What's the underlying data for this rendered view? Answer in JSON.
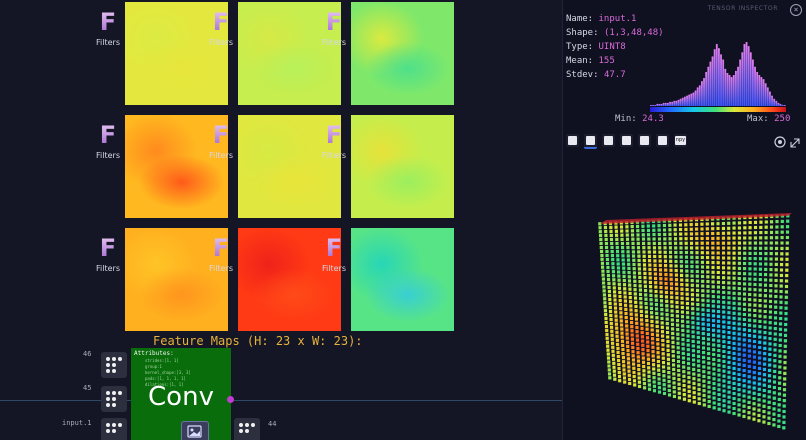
{
  "canvas": {
    "filter_label": "Filters",
    "filter_letter": "F",
    "feature_maps_caption": "Feature Maps (H: 23 x W: 23):",
    "rows": [
      {
        "maps": [
          {
            "colors": [
              "#e4e83e",
              "#dceb42",
              "#e6e63c"
            ]
          },
          {
            "colors": [
              "#c6ee4e",
              "#d6e946",
              "#b8f05a"
            ]
          },
          {
            "colors": [
              "#7fe86a",
              "#d9ea40",
              "#4fe08a"
            ]
          }
        ]
      },
      {
        "maps": [
          {
            "colors": [
              "#ffb81f",
              "#ff8a1e",
              "#ff5a1a"
            ]
          },
          {
            "colors": [
              "#e0e73e",
              "#d6ea44",
              "#e8e43a"
            ]
          },
          {
            "colors": [
              "#c5ee4c",
              "#e6e23a",
              "#9cee5e"
            ]
          }
        ]
      },
      {
        "maps": [
          {
            "colors": [
              "#ffb01f",
              "#ffc426",
              "#ff951e"
            ]
          },
          {
            "colors": [
              "#ff3a14",
              "#f0221a",
              "#ff4a18"
            ]
          },
          {
            "colors": [
              "#57e487",
              "#27d6b6",
              "#38cfd2"
            ]
          }
        ]
      }
    ]
  },
  "graph": {
    "node_numbers": {
      "n46": "46",
      "n45": "45",
      "n44": "44"
    },
    "input_label": "input.1",
    "conv": {
      "title": "Conv",
      "attributes_title": "Attributes:",
      "attributes": [
        "strides:[1, 1]",
        "group:1",
        "kernel_shape:[3, 3]",
        "pads:[1, 1, 1, 1]",
        "dilations:[1, 1]"
      ]
    }
  },
  "inspector": {
    "title": "TENSOR INSPECTOR",
    "name_label": "Name:",
    "name": "input.1",
    "shape_label": "Shape:",
    "shape": "(1,3,48,48)",
    "type_label": "Type:",
    "type": "UINT8",
    "mean_label": "Mean:",
    "mean": "155",
    "stdev_label": "Stdev:",
    "stdev": "47.7",
    "min_label": "Min:",
    "min": "24.3",
    "max_label": "Max:",
    "max": "250",
    "histogram_counts": [
      1,
      1,
      1,
      2,
      2,
      2,
      3,
      3,
      3,
      4,
      4,
      5,
      5,
      6,
      7,
      8,
      9,
      10,
      11,
      12,
      13,
      15,
      18,
      20,
      24,
      27,
      33,
      38,
      43,
      48,
      55,
      60,
      56,
      50,
      45,
      36,
      32,
      30,
      28,
      30,
      34,
      38,
      45,
      52,
      60,
      62,
      58,
      52,
      45,
      38,
      33,
      30,
      28,
      26,
      22,
      18,
      14,
      10,
      7,
      5,
      3,
      2,
      1,
      1
    ],
    "colors": {
      "accent": "#d86bd8",
      "bar_top": "#e17ef0",
      "bar_bottom": "#3a55ff"
    },
    "toolbar": [
      {
        "icon": "list-icon",
        "active": false
      },
      {
        "icon": "copy-icon",
        "active": true
      },
      {
        "icon": "grid-icon",
        "active": false
      },
      {
        "icon": "checker-icon",
        "active": false
      },
      {
        "icon": "percent-icon",
        "active": false
      },
      {
        "icon": "link-icon",
        "active": false
      },
      {
        "icon": "npy-icon",
        "text": "npy",
        "active": false
      }
    ]
  }
}
